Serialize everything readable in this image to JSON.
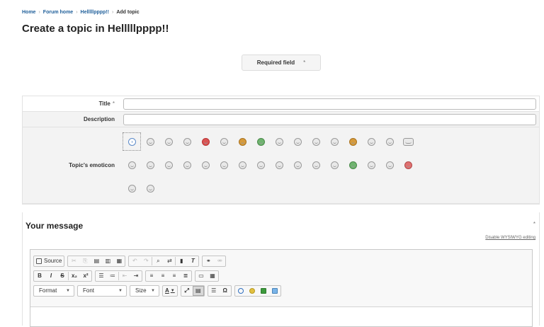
{
  "breadcrumb": {
    "home": "Home",
    "forum_home": "Forum home",
    "forum": "Helllllpppp!!",
    "current": "Add topic",
    "separator": "›"
  },
  "page_title": "Create a topic in Helllllpppp!!",
  "required_legend": {
    "label": "Required field",
    "star": "*"
  },
  "form": {
    "title_label": "Title",
    "required_star": "*",
    "title_value": "",
    "description_label": "Description",
    "description_value": "",
    "emoticon_label": "Topic's emoticon",
    "emoticons": [
      "smile-icon",
      "grin-icon",
      "happy-icon",
      "neutral-icon",
      "red-angry-icon",
      "cool-icon",
      "tongue-icon",
      "green-sick-icon",
      "wink-icon",
      "laugh-icon",
      "surprised-icon",
      "confused-icon",
      "devil-icon",
      "sad-icon",
      "cry-icon",
      "speech-icon",
      "sleepy-icon",
      "crazy-icon",
      "blink-icon",
      "biggrin-icon",
      "teeth-icon",
      "yawn-icon",
      "shock-icon",
      "frown-icon",
      "worried-icon",
      "rolleyes-icon",
      "smirk-icon",
      "evil-icon",
      "green-ill-icon",
      "kiss-icon",
      "blush-icon",
      "red-mad-icon",
      "nerd-icon",
      "thinking-icon"
    ],
    "selected_emoticon": "smile-icon"
  },
  "message": {
    "title": "Your message",
    "required_star": "*",
    "toggle_wysiwyg": "Disable WYSIWYG editing"
  },
  "editor": {
    "source_label": "Source",
    "format_label": "Format",
    "font_label": "Font",
    "size_label": "Size",
    "bold_glyph": "B",
    "italic_glyph": "I",
    "strike_glyph": "S",
    "subscript_glyph": "x₂",
    "superscript_glyph": "x²",
    "font_color_glyph": "A",
    "omega_glyph": "Ω"
  }
}
